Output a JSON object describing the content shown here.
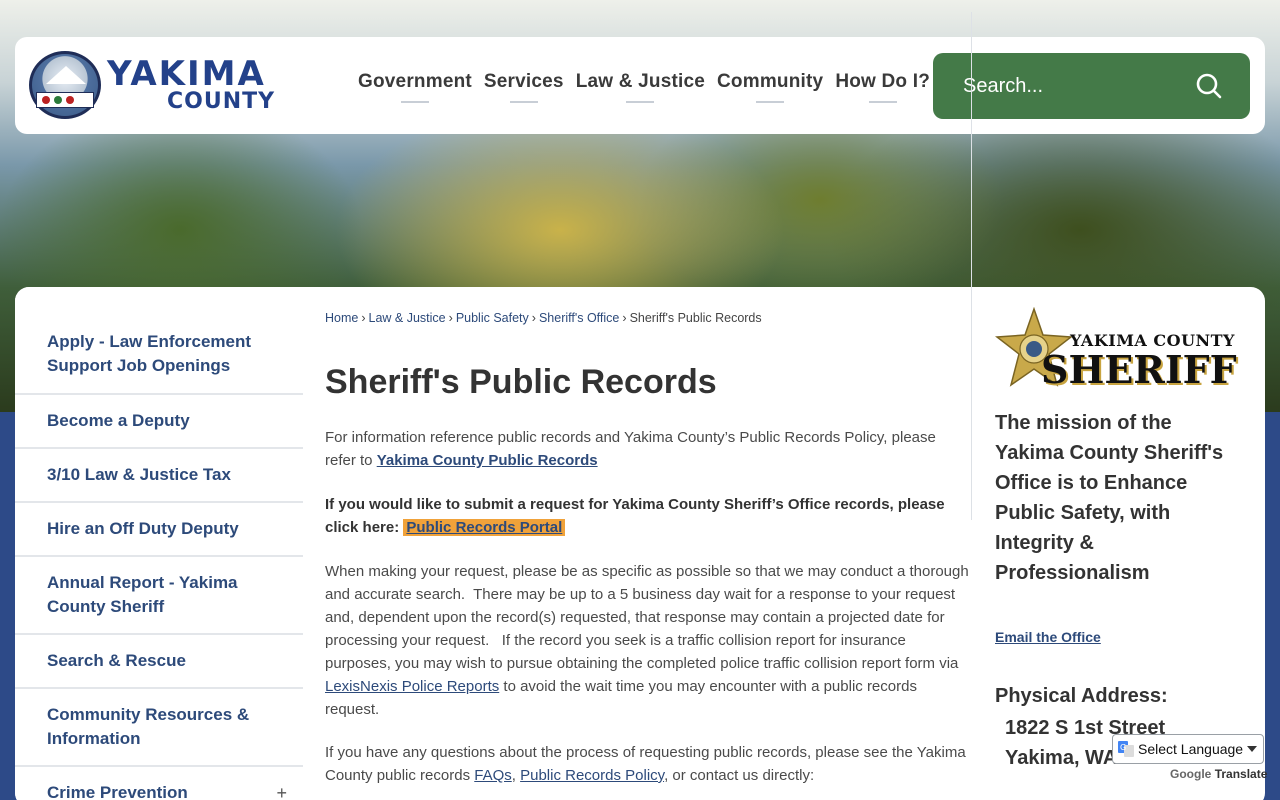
{
  "header": {
    "logo": {
      "line1": "YAKIMA",
      "line2": "COUNTY"
    },
    "nav": [
      "Government",
      "Services",
      "Law & Justice",
      "Community",
      "How Do I?"
    ],
    "search_placeholder": "Search...",
    "search_color": "#447a48"
  },
  "sidebar": {
    "items": [
      {
        "label": "Apply - Law Enforcement Support Job Openings"
      },
      {
        "label": "Become a Deputy"
      },
      {
        "label": "3/10 Law & Justice Tax"
      },
      {
        "label": "Hire an Off Duty Deputy"
      },
      {
        "label": "Annual Report - Yakima County Sheriff"
      },
      {
        "label": "Search & Rescue"
      },
      {
        "label": "Community Resources & Information"
      },
      {
        "label": "Crime Prevention",
        "expand": "+"
      }
    ]
  },
  "breadcrumb": [
    "Home",
    "Law & Justice",
    "Public Safety",
    "Sheriff's Office",
    "Sheriff's Public Records"
  ],
  "main": {
    "title": "Sheriff's Public Records",
    "p1_text": "For information reference public records and Yakima County’s Public Records Policy, please refer to ",
    "p1_link": "Yakima County Public Records",
    "p2_text": "If you would like to submit a request for Yakima County Sheriff’s Office records, please click here: ",
    "p2_link": "Public Records Portal",
    "p3_text_a": "When making your request, please be as specific as possible so that we may conduct a thorough and accurate search.  There may be up to a 5 business day wait for a response to your request and, dependent upon the record(s) requested, that response may contain a projected date for processing your request.   If the record you seek is a traffic collision report for insurance purposes, you may wish to pursue obtaining the completed police traffic collision report form via ",
    "p3_link": "LexisNexis Police Reports",
    "p3_text_b": " to avoid the wait time you may encounter with a public records request.",
    "p4_text_a": "If you have any questions about the process of requesting public records, please see the Yakima County public records ",
    "p4_link1": "FAQs",
    "p4_sep": ", ",
    "p4_link2": "Public Records Policy",
    "p4_text_b": ", or contact us directly:"
  },
  "right": {
    "logo_line1": "YAKIMA COUNTY",
    "logo_line2": "SHERIFF",
    "mission": "The mission of the Yakima County Sheriff's Office is to Enhance Public Safety, with Integrity & Professionalism",
    "email_link": "Email the Office",
    "address_label": "Physical Address:",
    "address_line1": "1822 S 1st Street",
    "address_line2": "Yakima, WA 98903"
  },
  "translate": {
    "select_label": "Select Language",
    "powered_brand": "Google",
    "powered_text": "Translate"
  },
  "colors": {
    "accent_blue": "#2d4a7a",
    "portal_highlight": "#f0a23a",
    "search_green": "#447a48"
  }
}
